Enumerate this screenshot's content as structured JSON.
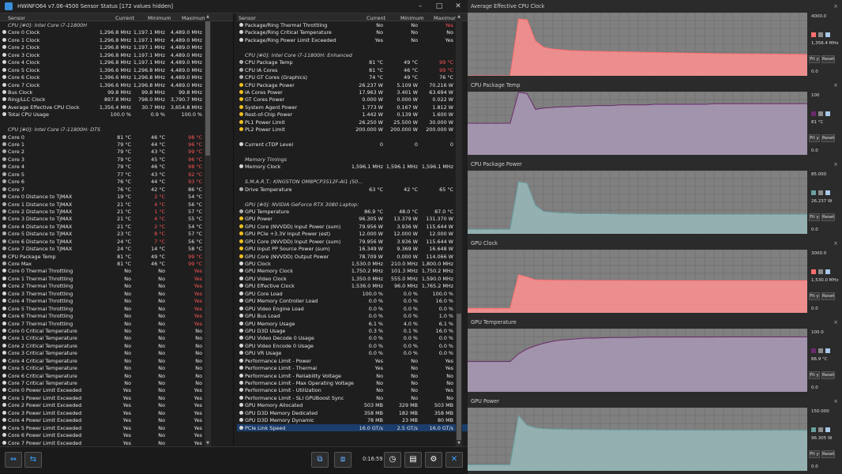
{
  "window": {
    "title": "HWiNFO64 v7.06-4500 Sensor Status [172 values hidden]"
  },
  "columns": {
    "sensor": "Sensor",
    "current": "Current",
    "minimum": "Minimum",
    "maximum": "Maximum"
  },
  "left_rows": [
    {
      "t": "grp",
      "n": "CPU [#0]: Intel Core i7-11800H"
    },
    {
      "t": "clk",
      "n": "Core 0 Clock",
      "c": "1,296.8 MHz",
      "mi": "1,197.1 MHz",
      "ma": "4,489.0 MHz"
    },
    {
      "t": "clk",
      "n": "Core 1 Clock",
      "c": "1,296.8 MHz",
      "mi": "1,197.1 MHz",
      "ma": "4,489.0 MHz"
    },
    {
      "t": "clk",
      "n": "Core 2 Clock",
      "c": "1,296.8 MHz",
      "mi": "1,197.1 MHz",
      "ma": "4,489.0 MHz"
    },
    {
      "t": "clk",
      "n": "Core 3 Clock",
      "c": "1,296.8 MHz",
      "mi": "1,197.1 MHz",
      "ma": "4,489.0 MHz"
    },
    {
      "t": "clk",
      "n": "Core 4 Clock",
      "c": "1,296.8 MHz",
      "mi": "1,197.1 MHz",
      "ma": "4,489.0 MHz"
    },
    {
      "t": "clk",
      "n": "Core 5 Clock",
      "c": "1,396.6 MHz",
      "mi": "1,296.8 MHz",
      "ma": "4,489.0 MHz"
    },
    {
      "t": "clk",
      "n": "Core 6 Clock",
      "c": "1,396.6 MHz",
      "mi": "1,296.8 MHz",
      "ma": "4,489.0 MHz"
    },
    {
      "t": "clk",
      "n": "Core 7 Clock",
      "c": "1,396.6 MHz",
      "mi": "1,296.8 MHz",
      "ma": "4,489.0 MHz"
    },
    {
      "t": "clk",
      "n": "Bus Clock",
      "c": "99.8 MHz",
      "mi": "99.8 MHz",
      "ma": "99.8 MHz"
    },
    {
      "t": "clk",
      "n": "Ring/LLC Clock",
      "c": "897.8 MHz",
      "mi": "798.0 MHz",
      "ma": "3,790.7 MHz"
    },
    {
      "t": "clk",
      "n": "Average Effective CPU Clock",
      "c": "1,356.4 MHz",
      "mi": "30.7 MHz",
      "ma": "3,654.8 MHz"
    },
    {
      "t": "use",
      "n": "Total CPU Usage",
      "c": "100.0 %",
      "mi": "0.9 %",
      "ma": "100.0 %"
    },
    {
      "t": "gap"
    },
    {
      "t": "grp",
      "n": "CPU [#0]: Intel Core i7-11800H: DTS"
    },
    {
      "t": "tmp",
      "n": "Core 0",
      "c": "81 °C",
      "mi": "46 °C",
      "ma": "98 °C",
      "r": "ma"
    },
    {
      "t": "tmp",
      "n": "Core 1",
      "c": "79 °C",
      "mi": "44 °C",
      "ma": "96 °C",
      "r": "ma"
    },
    {
      "t": "tmp",
      "n": "Core 2",
      "c": "79 °C",
      "mi": "43 °C",
      "ma": "99 °C",
      "r": "ma"
    },
    {
      "t": "tmp",
      "n": "Core 3",
      "c": "79 °C",
      "mi": "45 °C",
      "ma": "96 °C",
      "r": "ma"
    },
    {
      "t": "tmp",
      "n": "Core 4",
      "c": "79 °C",
      "mi": "46 °C",
      "ma": "98 °C",
      "r": "ma"
    },
    {
      "t": "tmp",
      "n": "Core 5",
      "c": "77 °C",
      "mi": "43 °C",
      "ma": "92 °C",
      "r": "ma"
    },
    {
      "t": "tmp",
      "n": "Core 6",
      "c": "76 °C",
      "mi": "44 °C",
      "ma": "93 °C",
      "r": "ma"
    },
    {
      "t": "tmp",
      "n": "Core 7",
      "c": "76 °C",
      "mi": "42 °C",
      "ma": "86 °C"
    },
    {
      "t": "tmp",
      "n": "Core 0 Distance to TjMAX",
      "c": "19 °C",
      "mi": "2 °C",
      "ma": "54 °C",
      "r": "mi"
    },
    {
      "t": "tmp",
      "n": "Core 1 Distance to TjMAX",
      "c": "21 °C",
      "mi": "4 °C",
      "ma": "56 °C",
      "r": "mi"
    },
    {
      "t": "tmp",
      "n": "Core 2 Distance to TjMAX",
      "c": "21 °C",
      "mi": "1 °C",
      "ma": "57 °C",
      "r": "mi"
    },
    {
      "t": "tmp",
      "n": "Core 3 Distance to TjMAX",
      "c": "21 °C",
      "mi": "4 °C",
      "ma": "55 °C",
      "r": "mi"
    },
    {
      "t": "tmp",
      "n": "Core 4 Distance to TjMAX",
      "c": "21 °C",
      "mi": "2 °C",
      "ma": "54 °C",
      "r": "mi"
    },
    {
      "t": "tmp",
      "n": "Core 5 Distance to TjMAX",
      "c": "23 °C",
      "mi": "8 °C",
      "ma": "57 °C",
      "r": "mi"
    },
    {
      "t": "tmp",
      "n": "Core 6 Distance to TjMAX",
      "c": "24 °C",
      "mi": "7 °C",
      "ma": "56 °C",
      "r": "mi"
    },
    {
      "t": "tmp",
      "n": "Core 7 Distance to TjMAX",
      "c": "24 °C",
      "mi": "14 °C",
      "ma": "58 °C"
    },
    {
      "t": "tmp",
      "n": "CPU Package Temp",
      "c": "81 °C",
      "mi": "49 °C",
      "ma": "99 °C",
      "r": "ma"
    },
    {
      "t": "tmp",
      "n": "Core Max",
      "c": "81 °C",
      "mi": "46 °C",
      "ma": "99 °C",
      "r": "ma"
    },
    {
      "t": "yn",
      "n": "Core 0 Thermal Throttling",
      "c": "No",
      "mi": "No",
      "ma": "Yes",
      "r": "ma"
    },
    {
      "t": "yn",
      "n": "Core 1 Thermal Throttling",
      "c": "No",
      "mi": "No",
      "ma": "Yes",
      "r": "ma"
    },
    {
      "t": "yn",
      "n": "Core 2 Thermal Throttling",
      "c": "No",
      "mi": "No",
      "ma": "Yes",
      "r": "ma"
    },
    {
      "t": "yn",
      "n": "Core 3 Thermal Throttling",
      "c": "No",
      "mi": "No",
      "ma": "Yes",
      "r": "ma"
    },
    {
      "t": "yn",
      "n": "Core 4 Thermal Throttling",
      "c": "No",
      "mi": "No",
      "ma": "Yes",
      "r": "ma"
    },
    {
      "t": "yn",
      "n": "Core 5 Thermal Throttling",
      "c": "No",
      "mi": "No",
      "ma": "Yes",
      "r": "ma"
    },
    {
      "t": "yn",
      "n": "Core 6 Thermal Throttling",
      "c": "No",
      "mi": "No",
      "ma": "Yes",
      "r": "ma"
    },
    {
      "t": "yn",
      "n": "Core 7 Thermal Throttling",
      "c": "No",
      "mi": "No",
      "ma": "Yes",
      "r": "ma"
    },
    {
      "t": "yn",
      "n": "Core 0 Critical Temperature",
      "c": "No",
      "mi": "No",
      "ma": "No"
    },
    {
      "t": "yn",
      "n": "Core 1 Critical Temperature",
      "c": "No",
      "mi": "No",
      "ma": "No"
    },
    {
      "t": "yn",
      "n": "Core 2 Critical Temperature",
      "c": "No",
      "mi": "No",
      "ma": "No"
    },
    {
      "t": "yn",
      "n": "Core 3 Critical Temperature",
      "c": "No",
      "mi": "No",
      "ma": "No"
    },
    {
      "t": "yn",
      "n": "Core 4 Critical Temperature",
      "c": "No",
      "mi": "No",
      "ma": "No"
    },
    {
      "t": "yn",
      "n": "Core 5 Critical Temperature",
      "c": "No",
      "mi": "No",
      "ma": "No"
    },
    {
      "t": "yn",
      "n": "Core 6 Critical Temperature",
      "c": "No",
      "mi": "No",
      "ma": "No"
    },
    {
      "t": "yn",
      "n": "Core 7 Critical Temperature",
      "c": "No",
      "mi": "No",
      "ma": "No"
    },
    {
      "t": "yn",
      "n": "Core 0 Power Limit Exceeded",
      "c": "Yes",
      "mi": "No",
      "ma": "Yes"
    },
    {
      "t": "yn",
      "n": "Core 1 Power Limit Exceeded",
      "c": "Yes",
      "mi": "No",
      "ma": "Yes"
    },
    {
      "t": "yn",
      "n": "Core 2 Power Limit Exceeded",
      "c": "Yes",
      "mi": "No",
      "ma": "Yes"
    },
    {
      "t": "yn",
      "n": "Core 3 Power Limit Exceeded",
      "c": "Yes",
      "mi": "No",
      "ma": "Yes"
    },
    {
      "t": "yn",
      "n": "Core 4 Power Limit Exceeded",
      "c": "Yes",
      "mi": "No",
      "ma": "Yes"
    },
    {
      "t": "yn",
      "n": "Core 5 Power Limit Exceeded",
      "c": "Yes",
      "mi": "No",
      "ma": "Yes"
    },
    {
      "t": "yn",
      "n": "Core 6 Power Limit Exceeded",
      "c": "Yes",
      "mi": "No",
      "ma": "Yes"
    },
    {
      "t": "yn",
      "n": "Core 7 Power Limit Exceeded",
      "c": "Yes",
      "mi": "No",
      "ma": "Yes"
    }
  ],
  "right_rows": [
    {
      "t": "yn",
      "n": "Package/Ring Thermal Throttling",
      "c": "No",
      "mi": "No",
      "ma": "Yes",
      "r": "ma"
    },
    {
      "t": "yn",
      "n": "Package/Ring Critical Temperature",
      "c": "No",
      "mi": "No",
      "ma": "No"
    },
    {
      "t": "yn",
      "n": "Package/Ring Power Limit Exceeded",
      "c": "Yes",
      "mi": "No",
      "ma": "Yes"
    },
    {
      "t": "gap"
    },
    {
      "t": "grp",
      "n": "CPU [#0]: Intel Core i7-11800H: Enhanced"
    },
    {
      "t": "tmp",
      "n": "CPU Package Temp",
      "c": "81 °C",
      "mi": "49 °C",
      "ma": "99 °C",
      "r": "ma"
    },
    {
      "t": "tmp",
      "n": "CPU IA Cores",
      "c": "81 °C",
      "mi": "46 °C",
      "ma": "99 °C",
      "r": "ma"
    },
    {
      "t": "tmp",
      "n": "CPU GT Cores (Graphics)",
      "c": "74 °C",
      "mi": "49 °C",
      "ma": "76 °C"
    },
    {
      "t": "pwr",
      "n": "CPU Package Power",
      "c": "26.237 W",
      "mi": "5.109 W",
      "ma": "70.216 W"
    },
    {
      "t": "pwr",
      "n": "IA Cores Power",
      "c": "17.963 W",
      "mi": "3.401 W",
      "ma": "63.694 W"
    },
    {
      "t": "pwr",
      "n": "GT Cores Power",
      "c": "0.000 W",
      "mi": "0.000 W",
      "ma": "0.022 W"
    },
    {
      "t": "pwr",
      "n": "System Agent Power",
      "c": "1.773 W",
      "mi": "0.167 W",
      "ma": "1.812 W"
    },
    {
      "t": "pwr",
      "n": "Rest-of-Chip Power",
      "c": "1.442 W",
      "mi": "0.139 W",
      "ma": "1.600 W"
    },
    {
      "t": "pwr",
      "n": "PL1 Power Limit",
      "c": "26.250 W",
      "mi": "25.500 W",
      "ma": "30.000 W"
    },
    {
      "t": "pwr",
      "n": "PL2 Power Limit",
      "c": "200.000 W",
      "mi": "200.000 W",
      "ma": "200.000 W"
    },
    {
      "t": "gap"
    },
    {
      "t": "use",
      "n": "Current cTDP Level",
      "c": "0",
      "mi": "0",
      "ma": "0"
    },
    {
      "t": "gap"
    },
    {
      "t": "grp",
      "n": "Memory Timings"
    },
    {
      "t": "clk",
      "n": "Memory Clock",
      "c": "1,596.1 MHz",
      "mi": "1,596.1 MHz",
      "ma": "1,596.1 MHz"
    },
    {
      "t": "gap"
    },
    {
      "t": "grp",
      "n": "S.M.A.R.T.: KINGSTON OM8PCP3512F-AI1 (50..."
    },
    {
      "t": "tmp",
      "n": "Drive Temperature",
      "c": "63 °C",
      "mi": "42 °C",
      "ma": "65 °C"
    },
    {
      "t": "gap"
    },
    {
      "t": "grp",
      "n": "GPU [#0]: NVIDIA GeForce RTX 3080 Laptop:"
    },
    {
      "t": "tmp",
      "n": "GPU Temperature",
      "c": "86.9 °C",
      "mi": "48.0 °C",
      "ma": "87.0 °C"
    },
    {
      "t": "pwr",
      "n": "GPU Power",
      "c": "96.305 W",
      "mi": "13.379 W",
      "ma": "131.370 W"
    },
    {
      "t": "pwr",
      "n": "GPU Core (NVVDD) Input Power (sum)",
      "c": "79.956 W",
      "mi": "3.936 W",
      "ma": "115.644 W"
    },
    {
      "t": "pwr",
      "n": "GPU PCIe +3.3V Input Power (est)",
      "c": "12.000 W",
      "mi": "12.000 W",
      "ma": "12.000 W"
    },
    {
      "t": "pwr",
      "n": "GPU Core (NVVDD) Input Power (sum)",
      "c": "79.956 W",
      "mi": "3.936 W",
      "ma": "115.644 W"
    },
    {
      "t": "pwr",
      "n": "GPU Input PP Source Power (sum)",
      "c": "16.349 W",
      "mi": "9.369 W",
      "ma": "16.648 W"
    },
    {
      "t": "pwr",
      "n": "GPU Core (NVVDD) Output Power",
      "c": "78.709 W",
      "mi": "0.000 W",
      "ma": "114.066 W"
    },
    {
      "t": "clk",
      "n": "GPU Clock",
      "c": "1,530.0 MHz",
      "mi": "210.0 MHz",
      "ma": "1,800.0 MHz"
    },
    {
      "t": "clk",
      "n": "GPU Memory Clock",
      "c": "1,750.2 MHz",
      "mi": "101.3 MHz",
      "ma": "1,750.2 MHz"
    },
    {
      "t": "clk",
      "n": "GPU Video Clock",
      "c": "1,350.0 MHz",
      "mi": "555.0 MHz",
      "ma": "1,590.0 MHz"
    },
    {
      "t": "clk",
      "n": "GPU Effective Clock",
      "c": "1,536.0 MHz",
      "mi": "96.0 MHz",
      "ma": "1,765.2 MHz"
    },
    {
      "t": "use",
      "n": "GPU Core Load",
      "c": "100.0 %",
      "mi": "0.0 %",
      "ma": "100.0 %"
    },
    {
      "t": "use",
      "n": "GPU Memory Controller Load",
      "c": "0.0 %",
      "mi": "0.0 %",
      "ma": "16.0 %"
    },
    {
      "t": "use",
      "n": "GPU Video Engine Load",
      "c": "0.0 %",
      "mi": "0.0 %",
      "ma": "0.0 %"
    },
    {
      "t": "use",
      "n": "GPU Bus Load",
      "c": "0.0 %",
      "mi": "0.0 %",
      "ma": "1.0 %"
    },
    {
      "t": "use",
      "n": "GPU Memory Usage",
      "c": "6.1 %",
      "mi": "4.0 %",
      "ma": "6.1 %"
    },
    {
      "t": "use",
      "n": "GPU D3D Usage",
      "c": "0.3 %",
      "mi": "0.1 %",
      "ma": "16.0 %"
    },
    {
      "t": "use",
      "n": "GPU Video Decode 0 Usage",
      "c": "0.0 %",
      "mi": "0.0 %",
      "ma": "0.0 %"
    },
    {
      "t": "use",
      "n": "GPU Video Encode 0 Usage",
      "c": "0.0 %",
      "mi": "0.0 %",
      "ma": "0.0 %"
    },
    {
      "t": "use",
      "n": "GPU VR Usage",
      "c": "0.0 %",
      "mi": "0.0 %",
      "ma": "0.0 %"
    },
    {
      "t": "yn",
      "n": "Performance Limit - Power",
      "c": "Yes",
      "mi": "No",
      "ma": "Yes"
    },
    {
      "t": "yn",
      "n": "Performance Limit - Thermal",
      "c": "Yes",
      "mi": "No",
      "ma": "Yes"
    },
    {
      "t": "yn",
      "n": "Performance Limit - Reliability Voltage",
      "c": "No",
      "mi": "No",
      "ma": "No"
    },
    {
      "t": "yn",
      "n": "Performance Limit - Max Operating Voltage",
      "c": "No",
      "mi": "No",
      "ma": "No"
    },
    {
      "t": "yn",
      "n": "Performance Limit - Utilization",
      "c": "No",
      "mi": "No",
      "ma": "Yes"
    },
    {
      "t": "yn",
      "n": "Performance Limit - SLI GPUBoost Sync",
      "c": "No",
      "mi": "No",
      "ma": "No"
    },
    {
      "t": "mem",
      "n": "GPU Memory Allocated",
      "c": "503 MB",
      "mi": "329 MB",
      "ma": "503 MB"
    },
    {
      "t": "mem",
      "n": "GPU D3D Memory Dedicated",
      "c": "358 MB",
      "mi": "182 MB",
      "ma": "358 MB"
    },
    {
      "t": "mem",
      "n": "GPU D3D Memory Dynamic",
      "c": "78 MB",
      "mi": "23 MB",
      "ma": "80 MB"
    },
    {
      "t": "link",
      "n": "PCIe Link Speed",
      "c": "16.0 GT/s",
      "mi": "2.5 GT/s",
      "ma": "16.0 GT/s",
      "sel": true
    }
  ],
  "status": {
    "timer": "0:16:59"
  },
  "icons": {
    "clk": "#d8d8d8",
    "use": "#d8d8d8",
    "tmp": "#b0b0b0",
    "pwr": "#f0c020",
    "yn": "#d8d8d8",
    "mem": "#d8d8d8",
    "link": "#d8d8d8"
  },
  "graph_buttons": {
    "fit": "Fit y",
    "reset": "Reset"
  },
  "chart_data": [
    {
      "type": "area",
      "title": "Average Effective CPU Clock",
      "ylim": [
        0,
        4000
      ],
      "ymax_label": "4000.0",
      "ymin_label": "0.0",
      "current_label": "1,356.4 MHz",
      "color": "#ff7070",
      "fill": "#ff9090",
      "y": [
        0,
        0,
        0,
        0,
        0,
        0,
        3600,
        3550,
        2200,
        1800,
        1700,
        1650,
        1600,
        1580,
        1560,
        1550,
        1540,
        1530,
        1520,
        1510,
        1500,
        1490,
        1480,
        1470,
        1460,
        1450,
        1440,
        1430,
        1420,
        1410,
        1400,
        1400,
        1395,
        1390,
        1385,
        1380,
        1375,
        1370,
        1365,
        1360,
        1356
      ]
    },
    {
      "type": "area",
      "title": "CPU Package Temp",
      "ylim": [
        0,
        100
      ],
      "ymax_label": "100",
      "ymin_label": "0.0",
      "current_label": "81 °C",
      "color": "#6a2a6a",
      "fill": "#a898b4",
      "y": [
        50,
        50,
        50,
        50,
        50,
        50,
        99,
        97,
        72,
        74,
        75,
        76,
        76,
        77,
        77,
        78,
        78,
        78,
        79,
        79,
        79,
        79,
        80,
        80,
        80,
        80,
        80,
        80,
        80,
        81,
        81,
        81,
        81,
        81,
        81,
        81,
        81,
        81,
        81,
        81,
        81
      ]
    },
    {
      "type": "area",
      "title": "CPU Package Power",
      "ylim": [
        0,
        85
      ],
      "ymax_label": "85.000",
      "ymin_label": "0.0",
      "current_label": "26.237 W",
      "color": "#6aa0a0",
      "fill": "#98b8b8",
      "y": [
        6,
        6,
        6,
        6,
        6,
        6,
        70,
        68,
        38,
        30,
        29,
        28,
        28,
        27,
        27,
        27,
        27,
        27,
        26.5,
        26.5,
        26.5,
        26.5,
        26.3,
        26.3,
        26.3,
        26.3,
        26.3,
        26.2,
        26.2,
        26.2,
        26.2,
        26.2,
        26.2,
        26.2,
        26.2,
        26.2,
        26.2,
        26.2,
        26.2,
        26.2,
        26.2
      ]
    },
    {
      "type": "area",
      "title": "GPU Clock",
      "ylim": [
        0,
        3000
      ],
      "ymax_label": "3000.0",
      "ymin_label": "0.0",
      "current_label": "1,530.0 MHz",
      "color": "#ff7070",
      "fill": "#ff9090",
      "y": [
        210,
        210,
        210,
        210,
        210,
        210,
        1800,
        1700,
        1560,
        1560,
        1550,
        1545,
        1540,
        1540,
        1535,
        1535,
        1535,
        1533,
        1532,
        1532,
        1531,
        1531,
        1530,
        1530,
        1530,
        1530,
        1530,
        1530,
        1530,
        1530,
        1530,
        1530,
        1530,
        1530,
        1530,
        1530,
        1530,
        1530,
        1530,
        1530,
        1530
      ]
    },
    {
      "type": "area",
      "title": "GPU Temperature",
      "ylim": [
        0,
        100
      ],
      "ymax_label": "100.0",
      "ymin_label": "0.0",
      "current_label": "86.9 °C",
      "color": "#6a2a6a",
      "fill": "#a898b4",
      "y": [
        48,
        48,
        48,
        48,
        48,
        48,
        60,
        68,
        73,
        77,
        80,
        82,
        83,
        84,
        85,
        85,
        85.5,
        86,
        86,
        86,
        86.3,
        86.5,
        86.5,
        86.6,
        86.7,
        86.7,
        86.8,
        86.8,
        86.8,
        86.8,
        86.9,
        86.9,
        86.9,
        86.9,
        86.9,
        86.9,
        86.9,
        86.9,
        86.9,
        86.9,
        86.9
      ]
    },
    {
      "type": "area",
      "title": "GPU Power",
      "ylim": [
        0,
        150
      ],
      "ymax_label": "150.000",
      "ymin_label": "0.0",
      "current_label": "96.305 W",
      "color": "#6aa0a0",
      "fill": "#98b8b8",
      "y": [
        14,
        14,
        14,
        14,
        14,
        14,
        131,
        108,
        102,
        100,
        99,
        99,
        98,
        98,
        98,
        97.5,
        97.5,
        97,
        97,
        97,
        97,
        96.8,
        96.8,
        96.6,
        96.6,
        96.5,
        96.5,
        96.5,
        96.4,
        96.4,
        96.4,
        96.4,
        96.3,
        96.3,
        96.3,
        96.3,
        96.3,
        96.3,
        96.3,
        96.3,
        96.3
      ]
    }
  ]
}
